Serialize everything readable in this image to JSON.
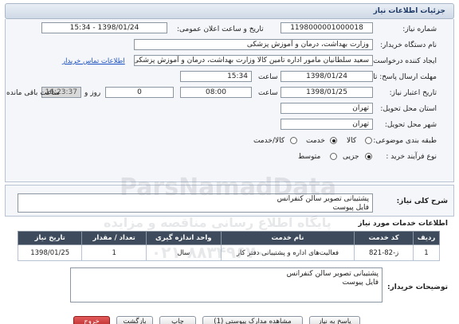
{
  "header": {
    "title": "جزئیات اطلاعات نیاز"
  },
  "fields": {
    "need_number_label": "شماره نیاز:",
    "need_number": "1198000001000018",
    "announce_label": "تاریخ و ساعت اعلان عمومی:",
    "announce_value": "1398/01/24 - 15:34",
    "buyer_org_label": "نام دستگاه خریدار:",
    "buyer_org": "وزارت بهداشت، درمان و آموزش پزشکی",
    "creator_label": "ایجاد کننده درخواست:",
    "creator": "سعید سلطانیان مامور اداره تامین کالا وزارت بهداشت، درمان و آموزش پزشکی",
    "contact_link": "اطلاعات تماس خریدار",
    "send_deadline_label": "مهلت ارسال پاسخ: تا تاریخ:",
    "send_date": "1398/01/24",
    "time_label": "ساعت",
    "send_time": "15:34",
    "validity_label": "تاریخ اعتبار نیاز:",
    "validity_date": "1398/01/25",
    "validity_time": "08:00",
    "days_value": "0",
    "days_label": "روز و",
    "remaining_time": "16:23:37",
    "remaining_label": "ساعت باقی مانده",
    "province_label": "استان محل تحویل:",
    "province": "تهران",
    "city_label": "شهر محل تحویل:",
    "city": "تهران",
    "category_label": "طبقه بندی موضوعی:",
    "category_options": [
      "کالا",
      "خدمت",
      "کالا/خدمت"
    ],
    "process_label": "نوع فرآیند خرید :",
    "process_options": [
      "جزیی",
      "متوسط"
    ]
  },
  "general_description": {
    "label": "شرح کلی نیاز:",
    "line1": "پشتیبانی تصویر  سالن کنفرانس",
    "line2": "فایل پیوست"
  },
  "services": {
    "section_title": "اطلاعات خدمات مورد نیاز",
    "columns": [
      "ردیف",
      "کد خدمت",
      "نام خدمت",
      "واحد اندازه گیری",
      "تعداد / مقدار",
      "تاریخ نیاز"
    ],
    "rows": [
      {
        "row": "1",
        "code": "ز-82-821",
        "name": "فعالیت‌های اداره و پشتیبانی دفتر کار",
        "unit": "سال",
        "qty": "1",
        "date": "1398/01/25"
      }
    ]
  },
  "buyer_notes": {
    "label": "توضیحات خریدار:",
    "line1": "پشتیبانی تصویر  سالن کنفرانس",
    "line2": "فایل پیوست"
  },
  "buttons": {
    "reply": "پاسخ به نیاز",
    "attachments": "مشاهده مدارک پیوستی (1)",
    "print": "چاپ",
    "back": "بازگشت",
    "exit": "خروج"
  },
  "watermark": {
    "brand": "ParsNamadData",
    "persian": "پایگاه اطلاع رسانی مناقصه و مزایده",
    "phone": "۰۲۱-۸۸۳۴۹۶۷۰"
  }
}
